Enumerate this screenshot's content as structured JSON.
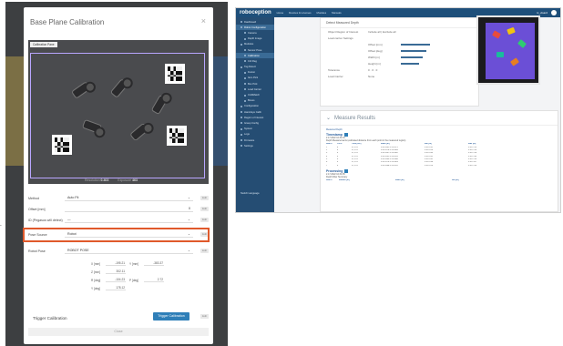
{
  "modal": {
    "title": "Base Plane Calibration",
    "close": "×",
    "camera_tab": "Calibration Pane",
    "status": [
      {
        "label": "Resolution",
        "value": "0.403"
      },
      {
        "label": "Exposure",
        "value": "463"
      }
    ],
    "fields": [
      {
        "label": "Method",
        "value": "Auto Fit"
      },
      {
        "label": "Offset [mm]",
        "value": "0"
      },
      {
        "label": "ID (Pegasus will detect)",
        "value": "—"
      },
      {
        "label": "Pose Source",
        "value": "Robot"
      },
      {
        "label": "Robot Pose",
        "value": "ROBOT POSE"
      }
    ],
    "pose": [
      {
        "k1": "X [mm]",
        "v1": "-195.21",
        "k2": "Y [mm]",
        "v2": "-383.37"
      },
      {
        "k1": "Z [mm]",
        "v1": "302.11",
        "k2": "",
        "v2": ""
      },
      {
        "k1": "R [deg]",
        "v1": "-104.23",
        "k2": "P [deg]",
        "v2": "2.72"
      },
      {
        "k1": "Y [deg]",
        "v1": "178.12",
        "k2": "",
        "v2": ""
      }
    ],
    "small_btn": "Edit",
    "trigger_label": "Trigger Calibration",
    "trigger_button": "Trigger Calibration",
    "close_button": "Close"
  },
  "app": {
    "brand": "roboception",
    "nav": [
      "Home",
      "Devices & Licenses",
      "Modules",
      "Manuals"
    ],
    "user": "rc_visard",
    "sidebar": [
      {
        "label": "Dashboard",
        "active": false,
        "sub": false
      },
      {
        "label": "Robot Configuration",
        "active": true,
        "sub": false
      },
      {
        "label": "Camera",
        "active": false,
        "sub": true
      },
      {
        "label": "Depth Image",
        "active": false,
        "sub": true
      },
      {
        "label": "Modules",
        "active": false,
        "sub": false
      },
      {
        "label": "Sensor Pose",
        "active": false,
        "sub": true
      },
      {
        "label": "Calibration",
        "active": true,
        "sub": true
      },
      {
        "label": "Ctrl Reg",
        "active": false,
        "sub": true
      },
      {
        "label": "Tag Detect",
        "active": false,
        "sub": false
      },
      {
        "label": "Fusion",
        "active": false,
        "sub": true
      },
      {
        "label": "Item Pick",
        "active": false,
        "sub": true
      },
      {
        "label": "Box Pick",
        "active": false,
        "sub": true
      },
      {
        "label": "Load Carrier",
        "active": false,
        "sub": true
      },
      {
        "label": "CADMatch",
        "active": false,
        "sub": true
      },
      {
        "label": "Boxes",
        "active": false,
        "sub": true
      },
      {
        "label": "Configuration",
        "active": false,
        "sub": false
      },
      {
        "label": "Hand-Eye Calib",
        "active": false,
        "sub": false
      },
      {
        "label": "Region of Interest",
        "active": false,
        "sub": false
      },
      {
        "label": "Grasp Config",
        "active": false,
        "sub": false
      },
      {
        "label": "System",
        "active": false,
        "sub": false
      },
      {
        "label": "Logs",
        "active": false,
        "sub": false
      },
      {
        "label": "Firmware",
        "active": false,
        "sub": false
      },
      {
        "label": "Settings",
        "active": false,
        "sub": false
      }
    ],
    "sidebar_footer": "Switch Language",
    "card1": {
      "header": "Detect Measured Depth",
      "rows": [
        {
          "k": "Object Region of Interest",
          "v": "Include all | Exclude all"
        },
        {
          "k": "Load carrier Settings",
          "v": ""
        },
        {
          "k": "",
          "v": "Offset [mm]"
        },
        {
          "k": "",
          "v": "Offset [deg]"
        },
        {
          "k": "",
          "v": "Width [m]"
        },
        {
          "k": "",
          "v": "Height [m]"
        },
        {
          "k": "Tolerance",
          "v": "0 · 0 · 0"
        },
        {
          "k": "Load Carrier",
          "v": "None"
        }
      ]
    },
    "card2": {
      "title": "Measure Results",
      "subtitle": "Measured Depth",
      "section1": "Timestamp",
      "date1": "2.17.2022 10:34:34",
      "desc1": "Depth Measurements (estimated distance from each point in the measured region)",
      "columns": [
        "Row #",
        "Col #",
        "Time [ms]",
        "Mean [m]",
        "Min [m]",
        "Max [m]"
      ],
      "rows": [
        [
          "1",
          "4",
          "37,278",
          "0.312481 0.312471",
          "0.312231",
          "0.312713"
        ],
        [
          "2",
          "4",
          "37,278",
          "0.312476 0.312469",
          "0.312224",
          "0.312714"
        ],
        [
          "3",
          "4",
          "37,278",
          "0.312487 0.312482",
          "0.312245",
          "0.312726"
        ],
        [
          "4",
          "4",
          "37,278",
          "0.312491 0.312476",
          "0.312252",
          "0.312733"
        ],
        [
          "5",
          "4",
          "37,278",
          "0.312483 0.312466",
          "0.312241",
          "0.312710"
        ],
        [
          "6",
          "4",
          "37,278",
          "0.312479 0.312463",
          "0.312238",
          "0.312707"
        ],
        [
          "7",
          "4",
          "37,278",
          "0.312488 0.312470",
          "0.312229",
          "0.312720"
        ]
      ],
      "section2": "Processing",
      "date2": "2.17.2022 10:34:35",
      "desc2": "Depth Filter Summary",
      "summary": [
        "Row #",
        "Median [m]",
        "Mean [m]",
        "Std [m]"
      ]
    }
  }
}
